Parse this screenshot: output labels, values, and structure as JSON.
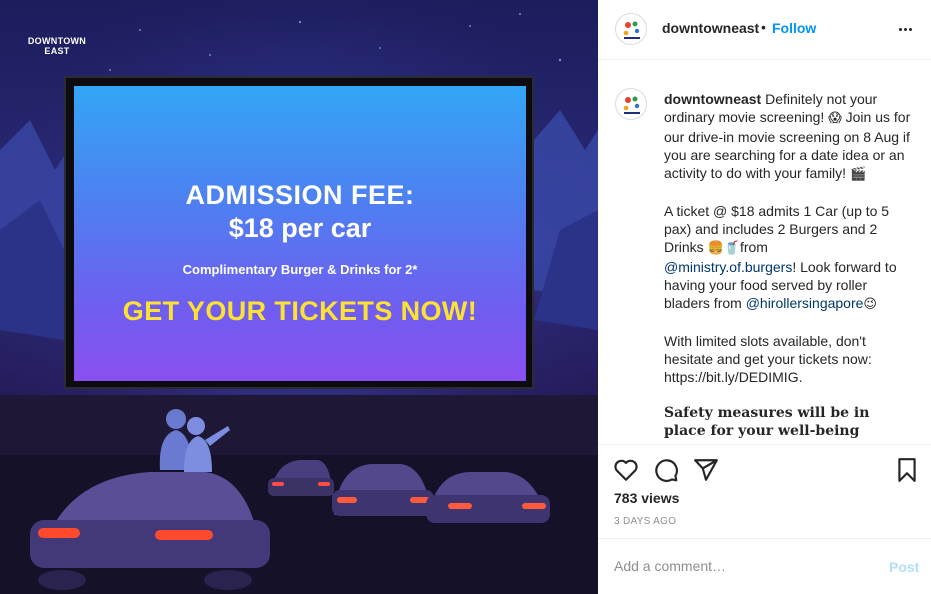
{
  "media": {
    "logo_text": "DOWNTOWN EAST",
    "screen": {
      "line1": "ADMISSION FEE:",
      "line2": "$18 per car",
      "line3": "Complimentary Burger & Drinks for 2*",
      "cta": "GET YOUR TICKETS NOW!"
    }
  },
  "header": {
    "username": "downtowneast",
    "separator": "•",
    "follow_label": "Follow",
    "more_icon": "more-horizontal-icon"
  },
  "caption": {
    "username": "downtowneast",
    "p1_text": " Definitely not your ordinary movie screening! ",
    "p1_emoji1": "😱",
    "p1_text2": " Join us for our drive-in movie screening on 8 Aug if you are searching for a date idea or an activity to do with your family! ",
    "p1_emoji2": "🎬",
    "p2_text": "A ticket @ $18 admits 1 Car (up to 5 pax) and includes 2 Burgers and 2 Drinks ",
    "p2_emoji": "🍔🥤",
    "p2_from": "from",
    "mention1": "@ministry.of.burgers",
    "p2_text2": "! Look forward to having your food served by roller bladers from ",
    "mention2": "@hirollersingapore",
    "p2_emoji2": "😉",
    "p3_text": "With limited slots available, don't hesitate and get your tickets now: https://bit.ly/DEDIMIG.",
    "safety_text": "Safety measures will be in place for your well-being"
  },
  "actions": {
    "like_icon": "heart-icon",
    "comment_icon": "comment-icon",
    "share_icon": "share-icon",
    "save_icon": "bookmark-icon"
  },
  "stats": {
    "views": "783 views",
    "time_ago": "3 DAYS AGO"
  },
  "comment": {
    "placeholder": "Add a comment…",
    "post_label": "Post"
  },
  "colors": {
    "accent": "#0095f6",
    "post_disabled": "#b2dffc",
    "cta_yellow": "#fde234"
  }
}
